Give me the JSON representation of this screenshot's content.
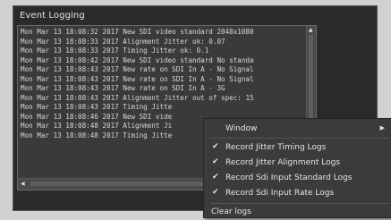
{
  "panel": {
    "title": "Event Logging"
  },
  "log_lines": [
    "Mon Mar 13 18:08:32 2017 New SDI video standard 2048x1080",
    "Mon Mar 13 18:08:33 2017 Alignment Jitter ok: 0.07",
    "Mon Mar 13 18:08:33 2017 Timing Jitter ok: 0.1",
    "Mon Mar 13 18:08:42 2017 New SDI video standard No standa",
    "Mon Mar 13 18:08:43 2017 New rate on SDI In A - No Signal",
    "Mon Mar 13 18:08:43 2017 New rate on SDI In A - No Signal",
    "Mon Mar 13 18:08:43 2017 New rate on SDI In A - 3G",
    "Mon Mar 13 18:08:43 2017 Alignment Jitter out of spec: 15",
    "Mon Mar 13 18:08:43 2017 Timing Jitte",
    "Mon Mar 13 18:08:46 2017 New SDI vide",
    "Mon Mar 13 18:08:48 2017 Alignment Ji",
    "Mon Mar 13 18:08:48 2017 Timing Jitte"
  ],
  "context_menu": {
    "window_label": "Window",
    "items": [
      {
        "label": "Record Jitter Timing Logs",
        "checked": true
      },
      {
        "label": "Record Jitter Alignment Logs",
        "checked": true
      },
      {
        "label": "Record Sdi Input Standard Logs",
        "checked": true
      },
      {
        "label": "Record Sdi Input Rate Logs",
        "checked": true
      }
    ],
    "clear_label": "Clear logs"
  },
  "icons": {
    "check": "check-icon",
    "submenu": "chevron-right-icon",
    "scroll_up": "scroll-up-arrow-icon",
    "scroll_left": "scroll-left-arrow-icon"
  }
}
